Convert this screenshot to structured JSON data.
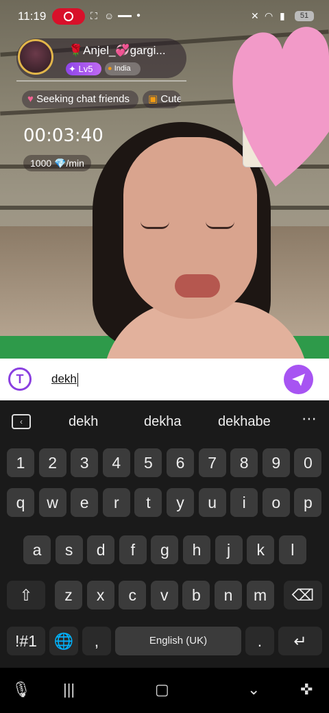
{
  "status_bar": {
    "time": "11:19",
    "battery": "51"
  },
  "streamer": {
    "name": "🌹Anjel_💞gargi...",
    "level": "Lv5",
    "country": "India"
  },
  "tags": [
    "Seeking chat friends",
    "Cute"
  ],
  "call": {
    "timer": "00:03:40",
    "rate": "1000 💎/min"
  },
  "input": {
    "value": "dekh"
  },
  "suggestions": [
    "dekh",
    "dekha",
    "dekhabe"
  ],
  "keys": {
    "row_numbers": [
      "1",
      "2",
      "3",
      "4",
      "5",
      "6",
      "7",
      "8",
      "9",
      "0"
    ],
    "row_top": [
      "q",
      "w",
      "e",
      "r",
      "t",
      "y",
      "u",
      "i",
      "o",
      "p"
    ],
    "row_mid": [
      "a",
      "s",
      "d",
      "f",
      "g",
      "h",
      "j",
      "k",
      "l"
    ],
    "row_bottom": [
      "z",
      "x",
      "c",
      "v",
      "b",
      "n",
      "m"
    ],
    "symbols_key": "!#1",
    "comma_key": ",",
    "space_label": "English (UK)",
    "period_key": "."
  },
  "icons": {
    "back_keyboard": "keyboard-hide-icon",
    "more": "more-icon",
    "shift": "shift-icon",
    "backspace": "backspace-icon",
    "globe": "globe-icon",
    "enter": "enter-icon",
    "send": "send-icon",
    "mic": "mic-icon",
    "recent": "recent-apps-icon",
    "home": "home-icon",
    "hide": "hide-keyboard-icon",
    "accessibility": "accessibility-icon"
  },
  "colors": {
    "accent": "#a754f2",
    "record": "#d8102a",
    "heart": "#f29ac8"
  }
}
